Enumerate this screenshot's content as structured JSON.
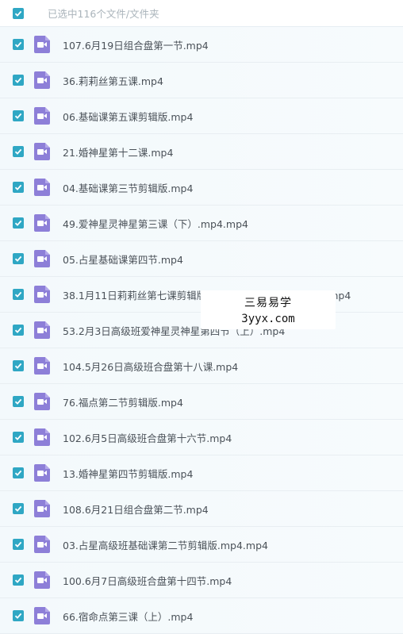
{
  "header": {
    "selection_label": "已选中116个文件/文件夹"
  },
  "files": [
    {
      "name": "107.6月19日组合盘第一节.mp4",
      "checked": true
    },
    {
      "name": "36.莉莉丝第五课.mp4",
      "checked": true
    },
    {
      "name": "06.基础课第五课剪辑版.mp4",
      "checked": true
    },
    {
      "name": "21.婚神星第十二课.mp4",
      "checked": true
    },
    {
      "name": "04.基础课第三节剪辑版.mp4",
      "checked": true
    },
    {
      "name": "49.爱神星灵神星第三课（下）.mp4.mp4",
      "checked": true
    },
    {
      "name": "05.占星基础课第四节.mp4",
      "checked": true
    },
    {
      "name": "38.1月11日莉莉丝第七课剪辑版（补充凯龙下降相位＋下降.mp4",
      "checked": true
    },
    {
      "name": "53.2月3日高级班爱神星灵神星第四节（上）.mp4",
      "checked": true
    },
    {
      "name": "104.5月26日高级班合盘第十八课.mp4",
      "checked": true
    },
    {
      "name": "76.福点第二节剪辑版.mp4",
      "checked": true
    },
    {
      "name": "102.6月5日高级班合盘第十六节.mp4",
      "checked": true
    },
    {
      "name": "13.婚神星第四节剪辑版.mp4",
      "checked": true
    },
    {
      "name": "108.6月21日组合盘第二节.mp4",
      "checked": true
    },
    {
      "name": "03.占星高级班基础课第二节剪辑版.mp4.mp4",
      "checked": true
    },
    {
      "name": "100.6月7日高级班合盘第十四节.mp4",
      "checked": true
    },
    {
      "name": "66.宿命点第三课（上）.mp4",
      "checked": true
    }
  ],
  "watermark": {
    "line1": "三易易学",
    "line2": "3yyx.com"
  },
  "colors": {
    "checkbox": "#2fa7c4",
    "video_icon": "#8d7fd8"
  },
  "icons": {
    "checkbox": "checkbox-checked-icon",
    "file": "video-file-icon"
  }
}
